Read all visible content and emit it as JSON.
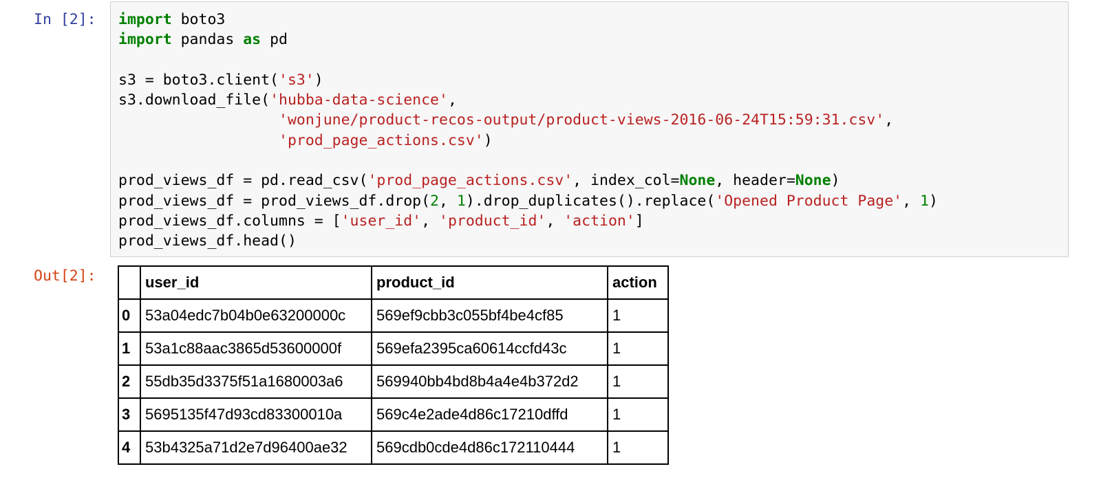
{
  "input_prompt": "In [2]:",
  "output_prompt": "Out[2]:",
  "code_lines": [
    [
      {
        "t": "import",
        "c": "kw"
      },
      {
        "t": " boto3",
        "c": ""
      }
    ],
    [
      {
        "t": "import",
        "c": "kw"
      },
      {
        "t": " pandas ",
        "c": ""
      },
      {
        "t": "as",
        "c": "kw"
      },
      {
        "t": " pd",
        "c": ""
      }
    ],
    [],
    [
      {
        "t": "s3 = boto3.client(",
        "c": ""
      },
      {
        "t": "'s3'",
        "c": "str"
      },
      {
        "t": ")",
        "c": ""
      }
    ],
    [
      {
        "t": "s3.download_file(",
        "c": ""
      },
      {
        "t": "'hubba-data-science'",
        "c": "str"
      },
      {
        "t": ",",
        "c": ""
      }
    ],
    [
      {
        "t": "                  ",
        "c": ""
      },
      {
        "t": "'wonjune/product-recos-output/product-views-2016-06-24T15:59:31.csv'",
        "c": "str"
      },
      {
        "t": ",",
        "c": ""
      }
    ],
    [
      {
        "t": "                  ",
        "c": ""
      },
      {
        "t": "'prod_page_actions.csv'",
        "c": "str"
      },
      {
        "t": ")",
        "c": ""
      }
    ],
    [],
    [
      {
        "t": "prod_views_df = pd.read_csv(",
        "c": ""
      },
      {
        "t": "'prod_page_actions.csv'",
        "c": "str"
      },
      {
        "t": ", index_col=",
        "c": ""
      },
      {
        "t": "None",
        "c": "kc"
      },
      {
        "t": ", header=",
        "c": ""
      },
      {
        "t": "None",
        "c": "kc"
      },
      {
        "t": ")",
        "c": ""
      }
    ],
    [
      {
        "t": "prod_views_df = prod_views_df.drop(",
        "c": ""
      },
      {
        "t": "2",
        "c": "num"
      },
      {
        "t": ", ",
        "c": ""
      },
      {
        "t": "1",
        "c": "num"
      },
      {
        "t": ").drop_duplicates().replace(",
        "c": ""
      },
      {
        "t": "'Opened Product Page'",
        "c": "str"
      },
      {
        "t": ", ",
        "c": ""
      },
      {
        "t": "1",
        "c": "num"
      },
      {
        "t": ")",
        "c": ""
      }
    ],
    [
      {
        "t": "prod_views_df.columns = [",
        "c": ""
      },
      {
        "t": "'user_id'",
        "c": "str"
      },
      {
        "t": ", ",
        "c": ""
      },
      {
        "t": "'product_id'",
        "c": "str"
      },
      {
        "t": ", ",
        "c": ""
      },
      {
        "t": "'action'",
        "c": "str"
      },
      {
        "t": "]",
        "c": ""
      }
    ],
    [
      {
        "t": "prod_views_df.head()",
        "c": ""
      }
    ]
  ],
  "table": {
    "columns": [
      "",
      "user_id",
      "product_id",
      "action"
    ],
    "rows": [
      [
        "0",
        "53a04edc7b04b0e63200000c",
        "569ef9cbb3c055bf4be4cf85",
        "1"
      ],
      [
        "1",
        "53a1c88aac3865d53600000f",
        "569efa2395ca60614ccfd43c",
        "1"
      ],
      [
        "2",
        "55db35d3375f51a1680003a6",
        "569940bb4bd8b4a4e4b372d2",
        "1"
      ],
      [
        "3",
        "5695135f47d93cd83300010a",
        "569c4e2ade4d86c17210dffd",
        "1"
      ],
      [
        "4",
        "53b4325a71d2e7d96400ae32",
        "569cdb0cde4d86c172110444",
        "1"
      ]
    ]
  },
  "colors": {
    "keyword": "#008000",
    "string": "#ba2121",
    "number": "#008000",
    "in_prompt": "#303f9f",
    "out_prompt": "#d84315",
    "cell_bg": "#f7f7f7"
  }
}
